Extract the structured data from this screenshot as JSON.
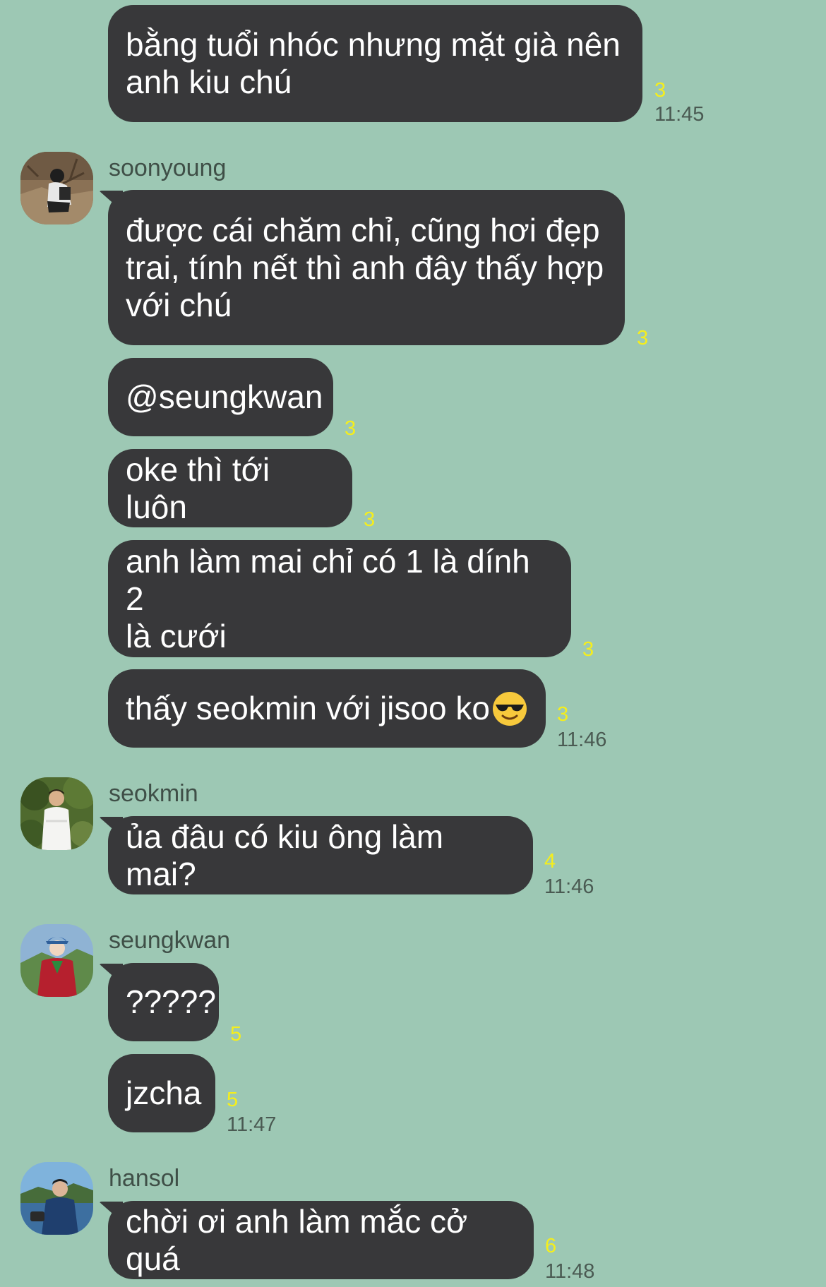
{
  "messages": [
    {
      "text": "bằng tuổi nhóc nhưng mặt già nên\nanh kiu chú",
      "read": "3",
      "time": "11:45"
    },
    {
      "sender": "soonyoung",
      "text": "được cái chăm chỉ, cũng hơi đẹp\ntrai, tính nết thì anh đây thấy hợp\nvới chú",
      "read": "3"
    },
    {
      "text": "@seungkwan",
      "read": "3"
    },
    {
      "text": "oke thì tới luôn",
      "read": "3"
    },
    {
      "text": "anh làm mai chỉ có 1 là dính 2\nlà cưới",
      "read": "3"
    },
    {
      "text": "thấy seokmin với jisoo ko",
      "emoji": "sunglasses-emoji",
      "read": "3",
      "time": "11:46"
    },
    {
      "sender": "seokmin",
      "text": "ủa đâu có kiu ông làm mai?",
      "read": "4",
      "time": "11:46"
    },
    {
      "sender": "seungkwan",
      "text": "?????",
      "read": "5"
    },
    {
      "text": "jzcha",
      "read": "5",
      "time": "11:47"
    },
    {
      "sender": "hansol",
      "text": "chời ơi anh làm mắc cở quá",
      "read": "6",
      "time": "11:48"
    }
  ],
  "colors": {
    "background": "#9dc8b4",
    "bubble": "#38383a",
    "bubble_text": "#ffffff",
    "read_count": "#f5ee1c",
    "time": "#4a5a52",
    "sender": "#3f4f47"
  }
}
